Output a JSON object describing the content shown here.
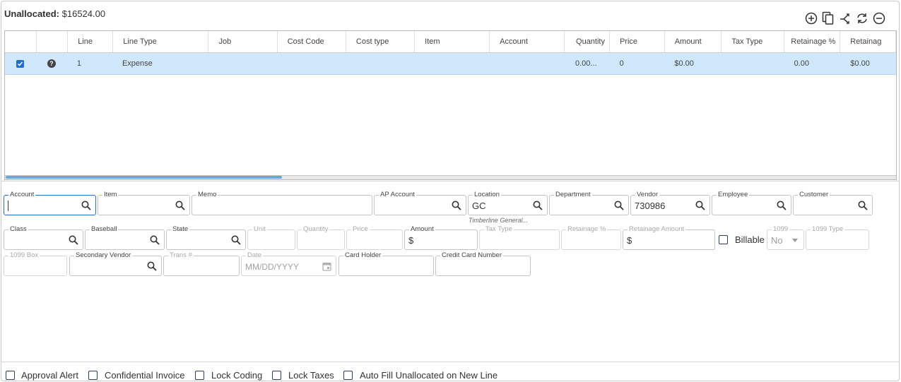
{
  "unallocated": {
    "label": "Unallocated:",
    "value": "$16524.00"
  },
  "toolbar": {
    "icons": [
      "add-circle-icon",
      "copy-icon",
      "split-icon",
      "refresh-icon",
      "remove-circle-icon"
    ]
  },
  "grid": {
    "headers": [
      "",
      "",
      "Line",
      "Line Type",
      "Job",
      "Cost Code",
      "Cost type",
      "Item",
      "Account",
      "Quantity",
      "Price",
      "Amount",
      "Tax Type",
      "Retainage %",
      "Retainag"
    ],
    "rows": [
      {
        "line": "1",
        "line_type": "Expense",
        "job": "",
        "cost_code": "",
        "cost_type": "",
        "item": "",
        "account": "",
        "quantity": "0.00...",
        "price": "0",
        "amount": "$0.00",
        "tax_type": "",
        "retainage_pct": "0.00",
        "retainage": "$0.00"
      }
    ],
    "scroll_fraction": 0.31
  },
  "form": {
    "account": {
      "label": "Account",
      "value": ""
    },
    "item": {
      "label": "Item",
      "value": ""
    },
    "memo": {
      "label": "Memo",
      "value": ""
    },
    "ap_account": {
      "label": "AP Account",
      "value": ""
    },
    "location": {
      "label": "Location",
      "value": "GC",
      "sub": "Timberline General..."
    },
    "department": {
      "label": "Department",
      "value": ""
    },
    "vendor": {
      "label": "Vendor",
      "value": "730986"
    },
    "employee": {
      "label": "Employee",
      "value": ""
    },
    "customer": {
      "label": "Customer",
      "value": ""
    },
    "class": {
      "label": "Class",
      "value": ""
    },
    "baseball": {
      "label": "Baseball",
      "value": ""
    },
    "state": {
      "label": "State",
      "value": ""
    },
    "unit": {
      "label": "Unit",
      "value": ""
    },
    "quantity": {
      "label": "Quantity",
      "value": ""
    },
    "price": {
      "label": "Price",
      "value": ""
    },
    "amount": {
      "label": "Amount",
      "value": "$"
    },
    "tax_type": {
      "label": "Tax Type",
      "value": ""
    },
    "retainage_pct": {
      "label": "Retainage %",
      "value": ""
    },
    "retainage_amount": {
      "label": "Retainage Amount",
      "value": "$"
    },
    "billable": {
      "label": "Billable",
      "checked": false
    },
    "f1099": {
      "label": "1099",
      "value": "No"
    },
    "f1099_type": {
      "label": "1099 Type",
      "value": ""
    },
    "f1099_box": {
      "label": "1099 Box",
      "value": ""
    },
    "secondary_vendor": {
      "label": "Secondary Vendor",
      "value": ""
    },
    "trans_no": {
      "label": "Trans #",
      "value": ""
    },
    "date": {
      "label": "Date",
      "placeholder": "MM/DD/YYYY"
    },
    "card_holder": {
      "label": "Card Holder",
      "value": ""
    },
    "card_number": {
      "label": "Credit Card Number",
      "value": ""
    }
  },
  "footer": {
    "approval_alert": "Approval Alert",
    "confidential_invoice": "Confidential Invoice",
    "lock_coding": "Lock Coding",
    "lock_taxes": "Lock Taxes",
    "auto_fill": "Auto Fill Unallocated on New Line"
  },
  "colors": {
    "accent": "#1e6fd0",
    "row_selected": "#cfe8fb",
    "scroll_thumb": "#6aa7e0"
  }
}
